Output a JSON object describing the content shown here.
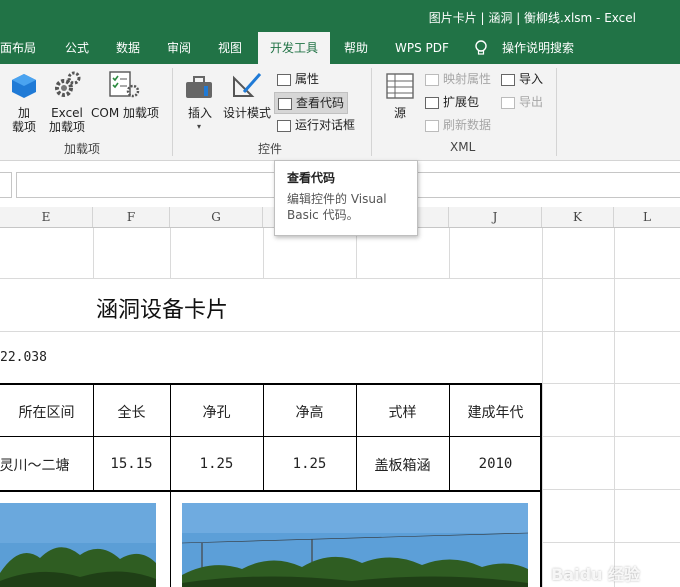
{
  "title": {
    "text": "图片卡片 | 涵洞 | 衡柳线.xlsm  -  Excel"
  },
  "tabs": [
    {
      "label": "面布局",
      "active": false
    },
    {
      "label": "公式",
      "active": false
    },
    {
      "label": "数据",
      "active": false
    },
    {
      "label": "审阅",
      "active": false
    },
    {
      "label": "视图",
      "active": false
    },
    {
      "label": "开发工具",
      "active": true
    },
    {
      "label": "帮助",
      "active": false
    },
    {
      "label": "WPS PDF",
      "active": false
    },
    {
      "label": "操作说明搜索",
      "active": false
    }
  ],
  "ribbon": {
    "addins": {
      "label": "加载项",
      "btn_addin": "加\n载项",
      "btn_excel_addin": "Excel\n加载项",
      "btn_com_addin": "COM 加载项"
    },
    "controls": {
      "label": "控件",
      "btn_insert": "插入",
      "btn_design": "设计模式",
      "btn_properties": "属性",
      "btn_view_code": "查看代码",
      "btn_run_dialog": "运行对话框"
    },
    "xml": {
      "label": "XML",
      "btn_source": "源",
      "btn_map_props": "映射属性",
      "btn_expansion": "扩展包",
      "btn_refresh": "刷新数据",
      "btn_import": "导入",
      "btn_export": "导出"
    }
  },
  "tooltip": {
    "title": "查看代码",
    "body": "编辑控件的 Visual Basic 代码。"
  },
  "columns": [
    "E",
    "F",
    "G",
    "H",
    "I",
    "J",
    "K",
    "L"
  ],
  "sheet": {
    "card_title": "涵洞设备卡片",
    "left_value": "22.038",
    "headers": [
      "所在区间",
      "全长",
      "净孔",
      "净高",
      "式样",
      "建成年代"
    ],
    "row": [
      "灵川～二塘",
      "15.15",
      "1.25",
      "1.25",
      "盖板箱涵",
      "2010"
    ]
  },
  "watermark": "Baidu 经验",
  "colors": {
    "excel_green": "#217346",
    "ribbon_bg": "#f3f3f3"
  }
}
